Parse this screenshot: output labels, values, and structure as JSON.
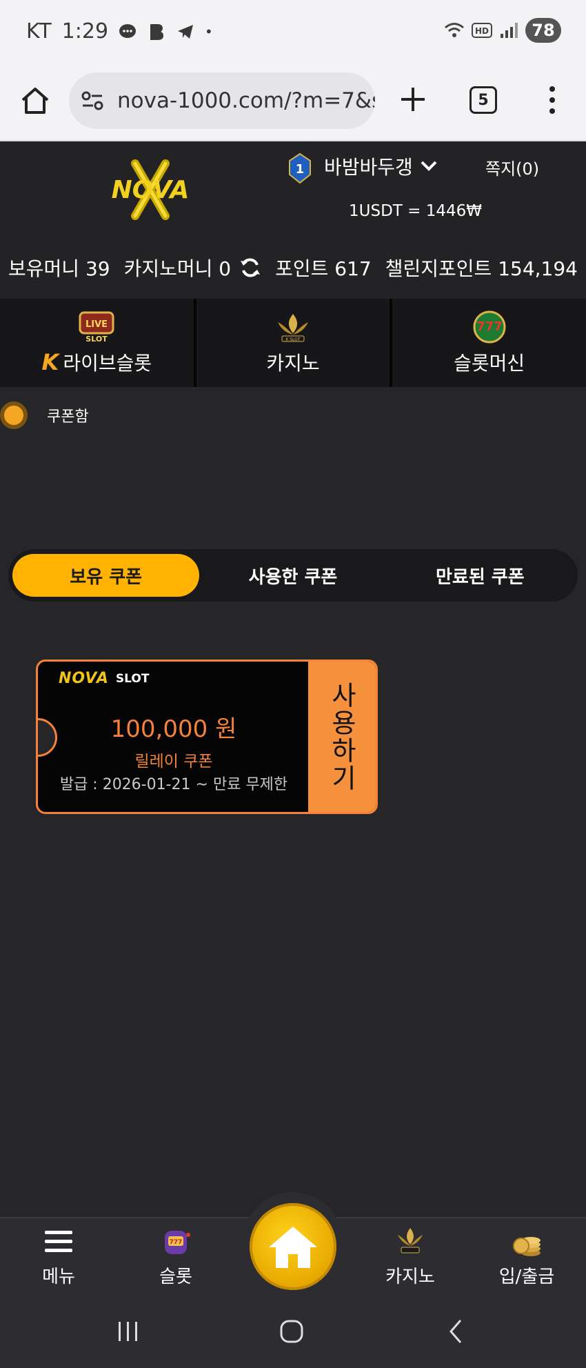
{
  "status_bar": {
    "carrier": "KT",
    "time": "1:29",
    "battery": "78"
  },
  "browser": {
    "url": "nova-1000.com/?m=7&s",
    "tab_count": "5"
  },
  "header": {
    "username": "바밤바두갱",
    "memo": "쪽지(0)",
    "rate": "1USDT = 1446₩",
    "user_level": "1"
  },
  "balances": {
    "hold_money": "보유머니 39",
    "casino_money": "카지노머니 0",
    "point": "포인트 617",
    "challenge_point": "챌린지포인트 154,194"
  },
  "categories": [
    {
      "label": "라이브슬롯",
      "icon": "live-slot-icon"
    },
    {
      "label": "카지노",
      "icon": "k-slot-icon"
    },
    {
      "label": "슬롯머신",
      "icon": "slots-777-icon"
    }
  ],
  "coupon_section": {
    "title": "쿠폰함",
    "tabs": [
      "보유 쿠폰",
      "사용한 쿠폰",
      "만료된 쿠폰"
    ],
    "active_tab": 0
  },
  "coupon_card": {
    "logo_text": "NOVA",
    "logo_sub": "SLOT",
    "amount": "100,000 원",
    "kind": "릴레이 쿠폰",
    "issue_info": "발급 : 2026-01-21 ~ 만료 무제한",
    "use_label": "사용하기"
  },
  "bottom_nav": {
    "menu": "메뉴",
    "slot": "슬롯",
    "casino": "카지노",
    "deposit": "입/출금"
  },
  "colors": {
    "accent": "#ffb300",
    "coupon_orange": "#f5823a",
    "background": "#262629"
  }
}
